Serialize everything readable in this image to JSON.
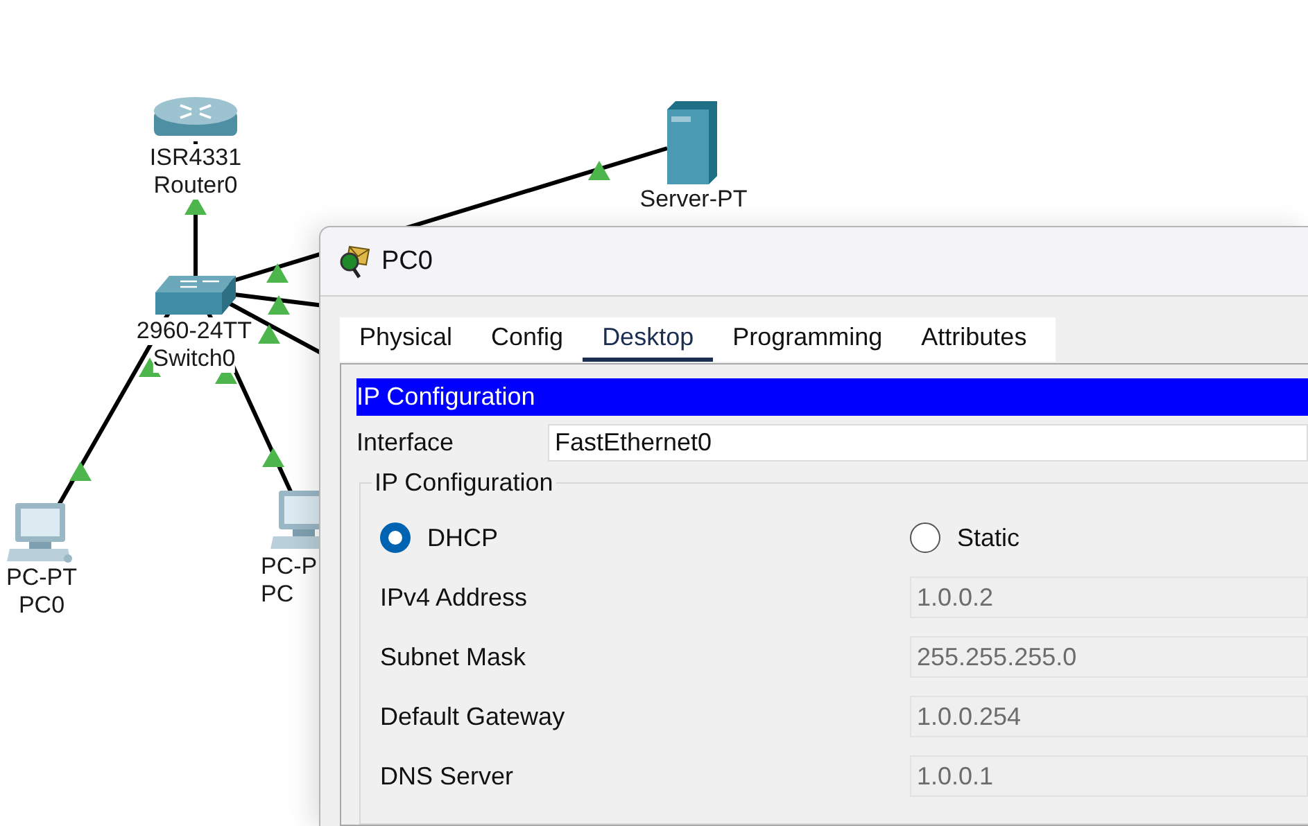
{
  "canvas": {
    "devices": [
      {
        "kind": "router",
        "model": "ISR4331",
        "name": "Router0"
      },
      {
        "kind": "server",
        "model": "Server-PT"
      },
      {
        "kind": "switch",
        "model": "2960-24TT",
        "name": "Switch0"
      },
      {
        "kind": "pc",
        "model": "PC-PT",
        "name": "PC0"
      },
      {
        "kind": "pc",
        "model": "PC-P",
        "name": "PC"
      }
    ],
    "links": [
      {
        "up": true
      },
      {
        "up": true
      },
      {
        "up": true
      },
      {
        "up": true
      },
      {
        "up": true
      },
      {
        "up": true
      }
    ]
  },
  "dialog": {
    "title": "PC0",
    "tabs": [
      {
        "label": "Physical",
        "selected": false
      },
      {
        "label": "Config",
        "selected": false
      },
      {
        "label": "Desktop",
        "selected": true
      },
      {
        "label": "Programming",
        "selected": false
      },
      {
        "label": "Attributes",
        "selected": false
      }
    ],
    "panel": {
      "title": "IP Configuration",
      "interface": {
        "label": "Interface",
        "value": "FastEthernet0"
      },
      "group": {
        "title": "IP Configuration",
        "modes": [
          {
            "label": "DHCP",
            "selected": true
          },
          {
            "label": "Static",
            "selected": false
          }
        ],
        "fields": [
          {
            "label": "IPv4 Address",
            "value": "1.0.0.2",
            "disabled": true
          },
          {
            "label": "Subnet Mask",
            "value": "255.255.255.0",
            "disabled": true
          },
          {
            "label": "Default Gateway",
            "value": "1.0.0.254",
            "disabled": true
          },
          {
            "label": "DNS Server",
            "value": "1.0.0.1",
            "disabled": true
          }
        ]
      }
    }
  }
}
